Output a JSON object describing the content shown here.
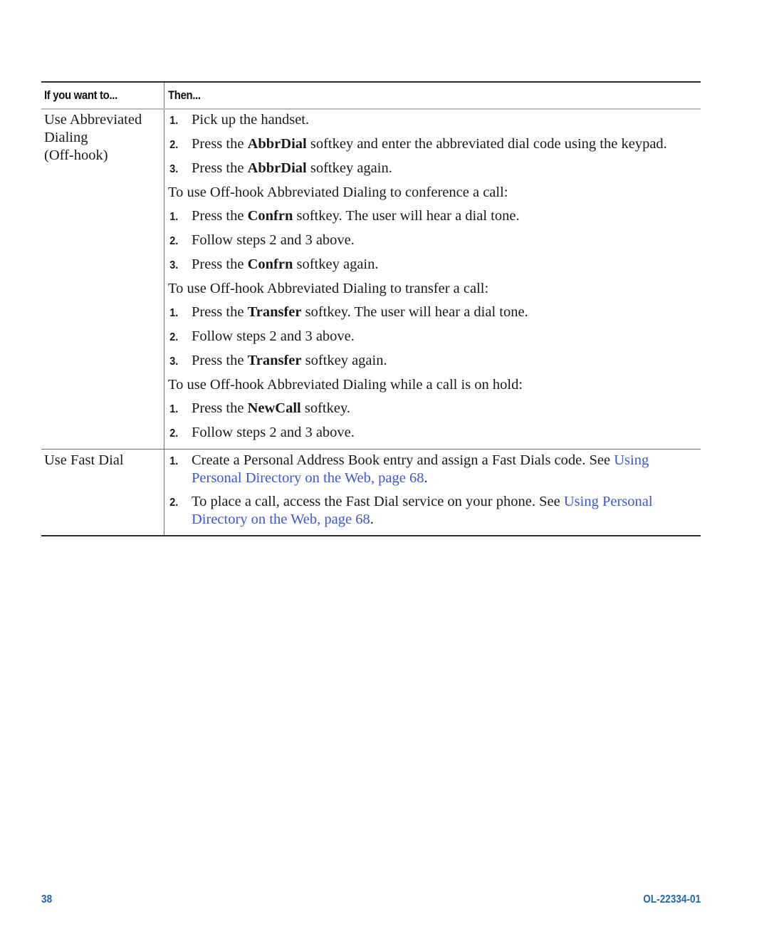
{
  "table": {
    "headers": {
      "col1": "If you want to...",
      "col2": "Then..."
    },
    "abbreviated": {
      "label": [
        "Use Abbreviated",
        "Dialing",
        "(Off-hook)"
      ],
      "steps_main": [
        {
          "num": "1.",
          "pre": "Pick up the handset.",
          "bold": "",
          "post": ""
        },
        {
          "num": "2.",
          "pre": "Press the ",
          "bold": "AbbrDial",
          "post": " softkey and enter the abbreviated dial code using the keypad."
        },
        {
          "num": "3.",
          "pre": "Press the ",
          "bold": "AbbrDial",
          "post": " softkey again."
        }
      ],
      "conference_intro": "To use Off-hook Abbreviated Dialing to conference a call:",
      "steps_conference": [
        {
          "num": "1.",
          "pre": "Press the ",
          "bold": "Confrn",
          "post": " softkey. The user will hear a dial tone."
        },
        {
          "num": "2.",
          "pre": "Follow steps 2 and 3 above.",
          "bold": "",
          "post": ""
        },
        {
          "num": "3.",
          "pre": "Press the ",
          "bold": "Confrn",
          "post": " softkey again."
        }
      ],
      "transfer_intro": "To use Off-hook Abbreviated Dialing to transfer a call:",
      "steps_transfer": [
        {
          "num": "1.",
          "pre": "Press the ",
          "bold": "Transfer",
          "post": " softkey. The user will hear a dial tone."
        },
        {
          "num": "2.",
          "pre": "Follow steps 2 and 3 above.",
          "bold": "",
          "post": ""
        },
        {
          "num": "3.",
          "pre": "Press the ",
          "bold": "Transfer",
          "post": " softkey again."
        }
      ],
      "hold_intro": "To use Off-hook Abbreviated Dialing while a call is on hold:",
      "steps_hold": [
        {
          "num": "1.",
          "pre": "Press the ",
          "bold": "NewCall",
          "post": " softkey."
        },
        {
          "num": "2.",
          "pre": "Follow steps 2 and 3 above.",
          "bold": "",
          "post": ""
        }
      ]
    },
    "fastdial": {
      "label": "Use Fast Dial",
      "steps": [
        {
          "num": "1.",
          "pre": "Create a Personal Address Book entry and assign a Fast Dials code. See ",
          "link": "Using Personal Directory on the Web, page 68",
          "post": "."
        },
        {
          "num": "2.",
          "pre": "To place a call, access the Fast Dial service on your phone. See ",
          "link": "Using Personal Directory on the Web, page 68",
          "post": "."
        }
      ]
    }
  },
  "footer": {
    "page_number": "38",
    "doc_id": "OL-22334-01"
  },
  "colors": {
    "link": "#3a58d6",
    "footer": "#2065ad"
  }
}
